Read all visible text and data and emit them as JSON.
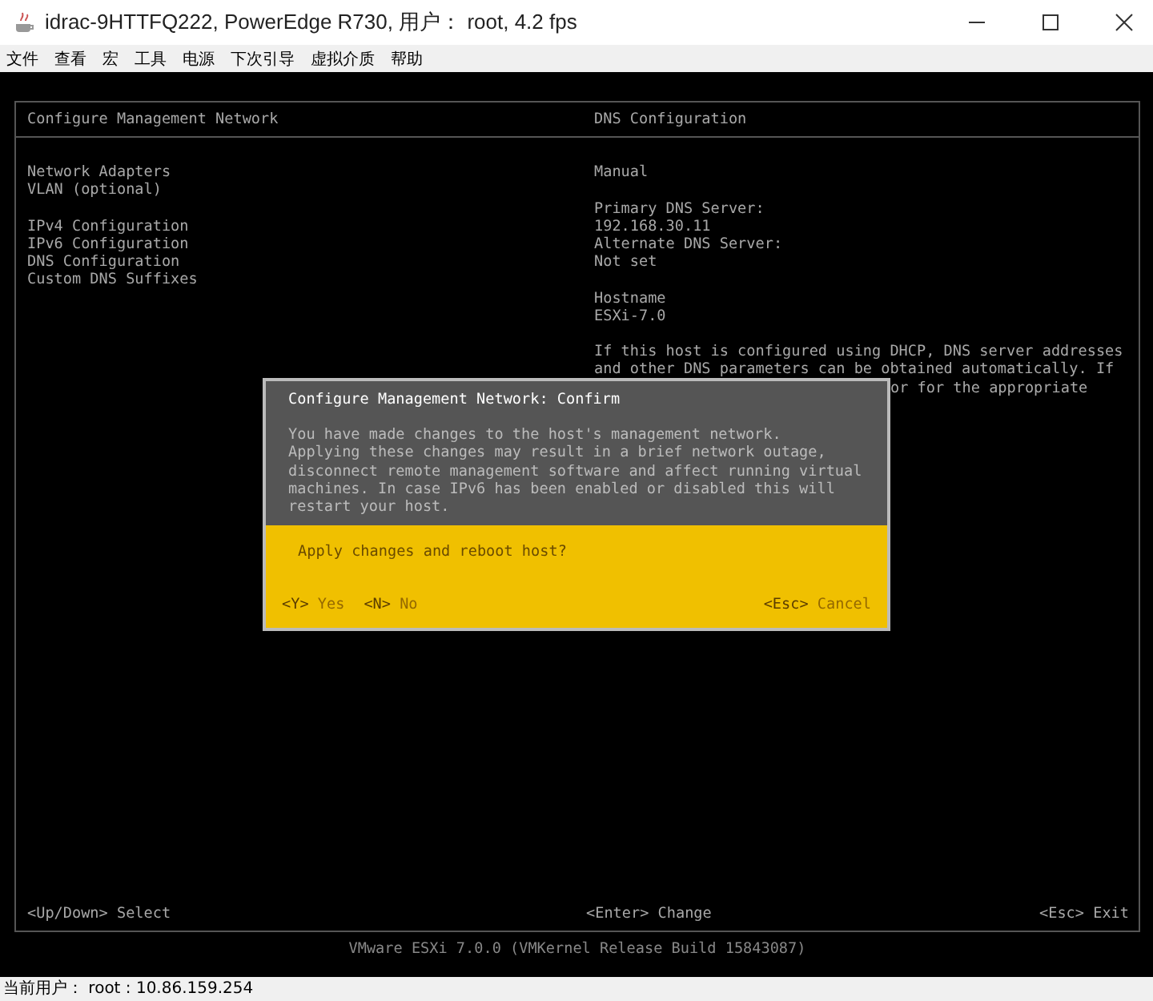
{
  "window": {
    "title": "idrac-9HTTFQ222, PowerEdge R730, 用户： root, 4.2 fps"
  },
  "menu": [
    "文件",
    "查看",
    "宏",
    "工具",
    "电源",
    "下次引导",
    "虚拟介质",
    "帮助"
  ],
  "console": {
    "left_title": "Configure Management Network",
    "right_title": "DNS Configuration",
    "menu_groups": [
      [
        "Network Adapters",
        "VLAN (optional)"
      ],
      [
        "IPv4 Configuration",
        "IPv6 Configuration",
        "DNS Configuration",
        "Custom DNS Suffixes"
      ]
    ],
    "detail_groups": [
      [
        "Manual"
      ],
      [
        "Primary DNS Server:",
        "192.168.30.11",
        "Alternate DNS Server:",
        "Not set"
      ],
      [
        "Hostname",
        "ESXi-7.0"
      ]
    ],
    "note_lines": [
      "If this host is configured using DHCP, DNS server addresses",
      "and other DNS parameters can be obtained automatically. If",
      "or for the appropriate"
    ],
    "footer": {
      "left": "<Up/Down> Select",
      "center": "<Enter> Change",
      "right": "<Esc> Exit"
    },
    "version": "VMware ESXi 7.0.0 (VMKernel Release Build 15843087)"
  },
  "dialog": {
    "title": "Configure Management Network: Confirm",
    "message": "You have made changes to the host's management network.\nApplying these changes may result in a brief network outage,\ndisconnect remote management software and affect running virtual\nmachines. In case IPv6 has been enabled or disabled this will\nrestart your host.",
    "question": "Apply changes and reboot host?",
    "left_actions": [
      {
        "key": "<Y>",
        "label": "Yes"
      },
      {
        "key": "<N>",
        "label": "No"
      }
    ],
    "right_actions": [
      {
        "key": "<Esc>",
        "label": "Cancel"
      }
    ]
  },
  "status_bar": "当前用户： root : 10.86.159.254"
}
